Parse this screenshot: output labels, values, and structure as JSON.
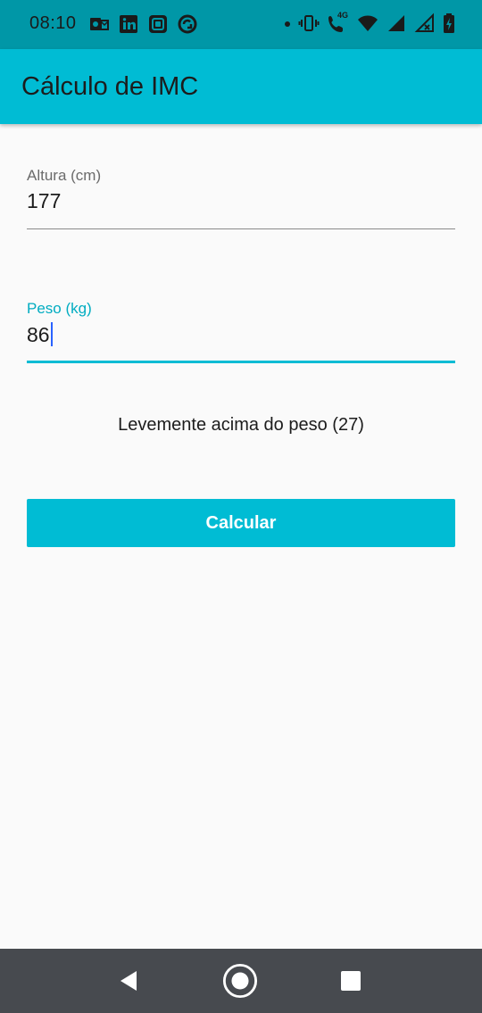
{
  "status_bar": {
    "time": "08:10",
    "left_icons": [
      "outlook-icon",
      "linkedin-icon",
      "app-icon",
      "sync-icon"
    ],
    "right_icons": [
      "dot-icon",
      "vibrate-icon",
      "wifi-call-icon",
      "wifi-icon",
      "signal-icon",
      "signal-x-icon",
      "battery-icon"
    ],
    "network_label": "4G"
  },
  "app_bar": {
    "title": "Cálculo de IMC",
    "color": "#00bcd4"
  },
  "form": {
    "height": {
      "label": "Altura (cm)",
      "value": "177"
    },
    "weight": {
      "label": "Peso (kg)",
      "value": "86"
    }
  },
  "result": {
    "text": "Levemente acima do peso (27)"
  },
  "button": {
    "label": "Calcular"
  },
  "nav_bar": {
    "icons": [
      "back-icon",
      "home-icon",
      "recents-icon"
    ]
  }
}
